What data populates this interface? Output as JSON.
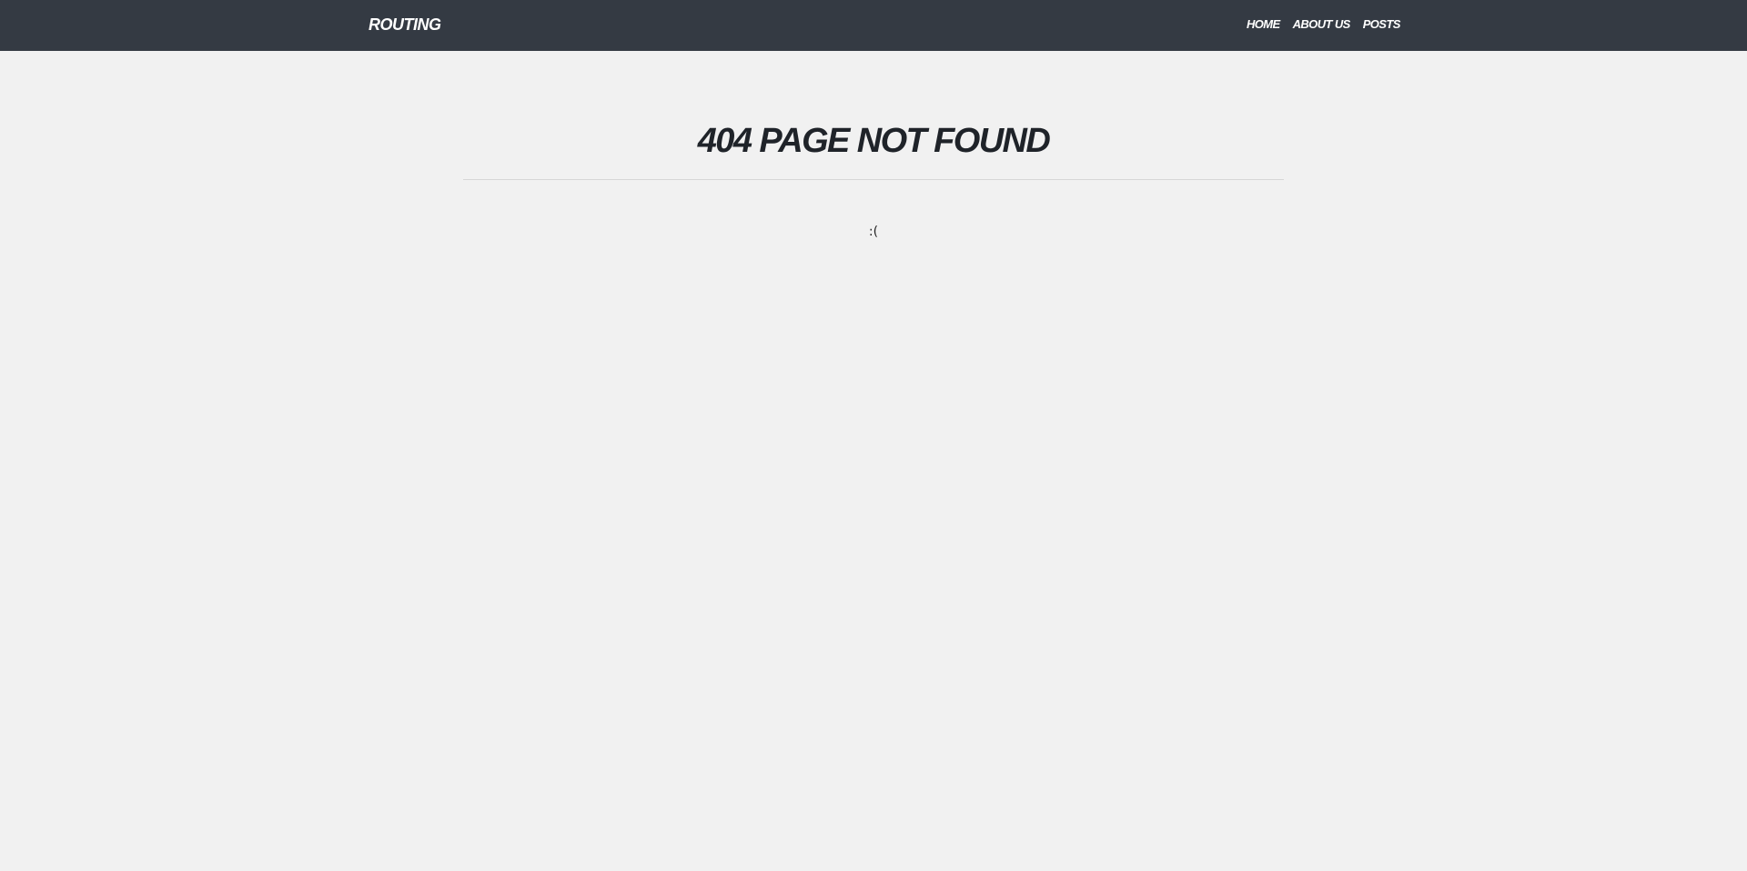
{
  "header": {
    "brand": "ROUTING",
    "nav": [
      {
        "label": "HOME"
      },
      {
        "label": "ABOUT US"
      },
      {
        "label": "POSTS"
      }
    ]
  },
  "main": {
    "title": "404 PAGE NOT FOUND",
    "message": ":("
  },
  "colors": {
    "header_bg": "#343a43",
    "page_bg": "#f1f1f1",
    "title_text": "#1f2329",
    "divider": "#d6d6d6"
  }
}
